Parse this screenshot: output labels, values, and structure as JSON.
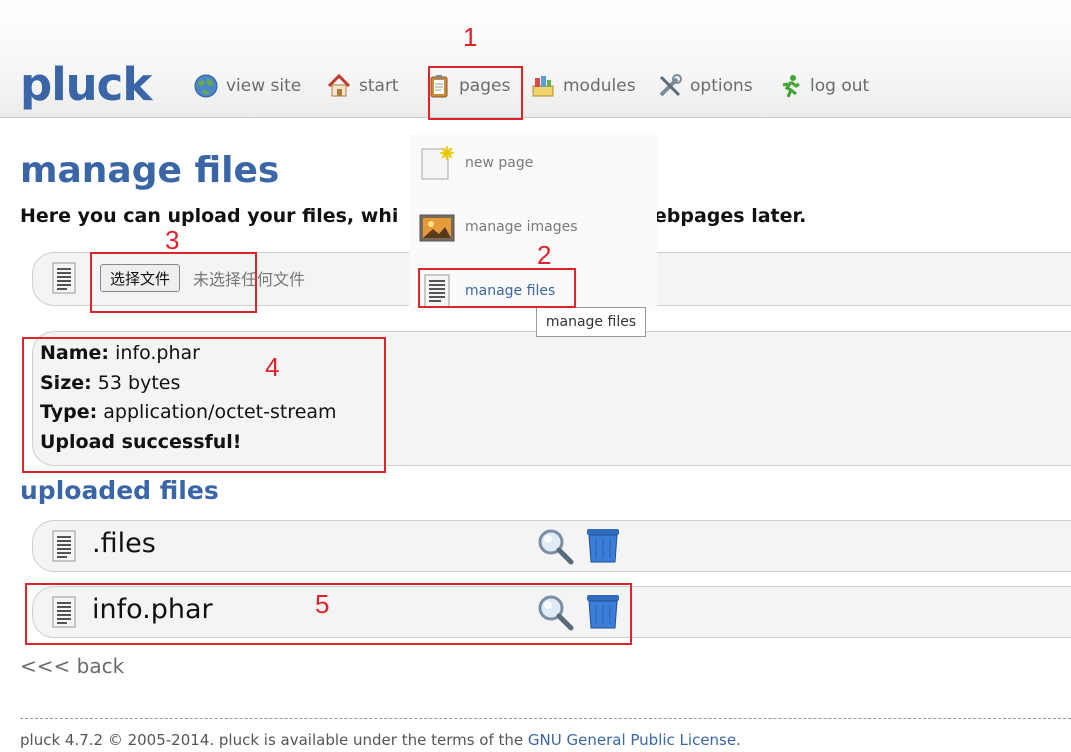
{
  "header": {
    "logo": "pluck",
    "nav": [
      {
        "label": "view site",
        "icon": "globe-icon"
      },
      {
        "label": "start",
        "icon": "home-icon"
      },
      {
        "label": "pages",
        "icon": "clipboard-icon"
      },
      {
        "label": "modules",
        "icon": "modules-icon"
      },
      {
        "label": "options",
        "icon": "tools-icon"
      },
      {
        "label": "log out",
        "icon": "running-man-icon"
      }
    ]
  },
  "dropdown": {
    "items": [
      {
        "label": "new page",
        "icon": "new-page-icon"
      },
      {
        "label": "manage images",
        "icon": "image-icon"
      },
      {
        "label": "manage files",
        "icon": "file-icon"
      }
    ],
    "tooltip": "manage files"
  },
  "main": {
    "title": "manage files",
    "subtitle_start": "Here you can upload your files, whi",
    "subtitle_end": "r webpages later.",
    "file_button": "选择文件",
    "file_none": "未选择任何文件",
    "result": {
      "name_label": "Name:",
      "name_value": "info.phar",
      "size_label": "Size:",
      "size_value": "53 bytes",
      "type_label": "Type:",
      "type_value": "application/octet-stream",
      "status": "Upload successful!"
    },
    "uploaded_title": "uploaded files",
    "files": [
      {
        "name": ".files"
      },
      {
        "name": "info.phar"
      }
    ],
    "back": "<<< back"
  },
  "footer": {
    "text": "pluck 4.7.2 © 2005-2014. pluck is available under the terms of the ",
    "link": "GNU General Public License",
    "end": "."
  },
  "annotations": [
    "1",
    "2",
    "3",
    "4",
    "5"
  ],
  "colors": {
    "accent": "#3a66a8",
    "annotation": "#e0222a"
  }
}
